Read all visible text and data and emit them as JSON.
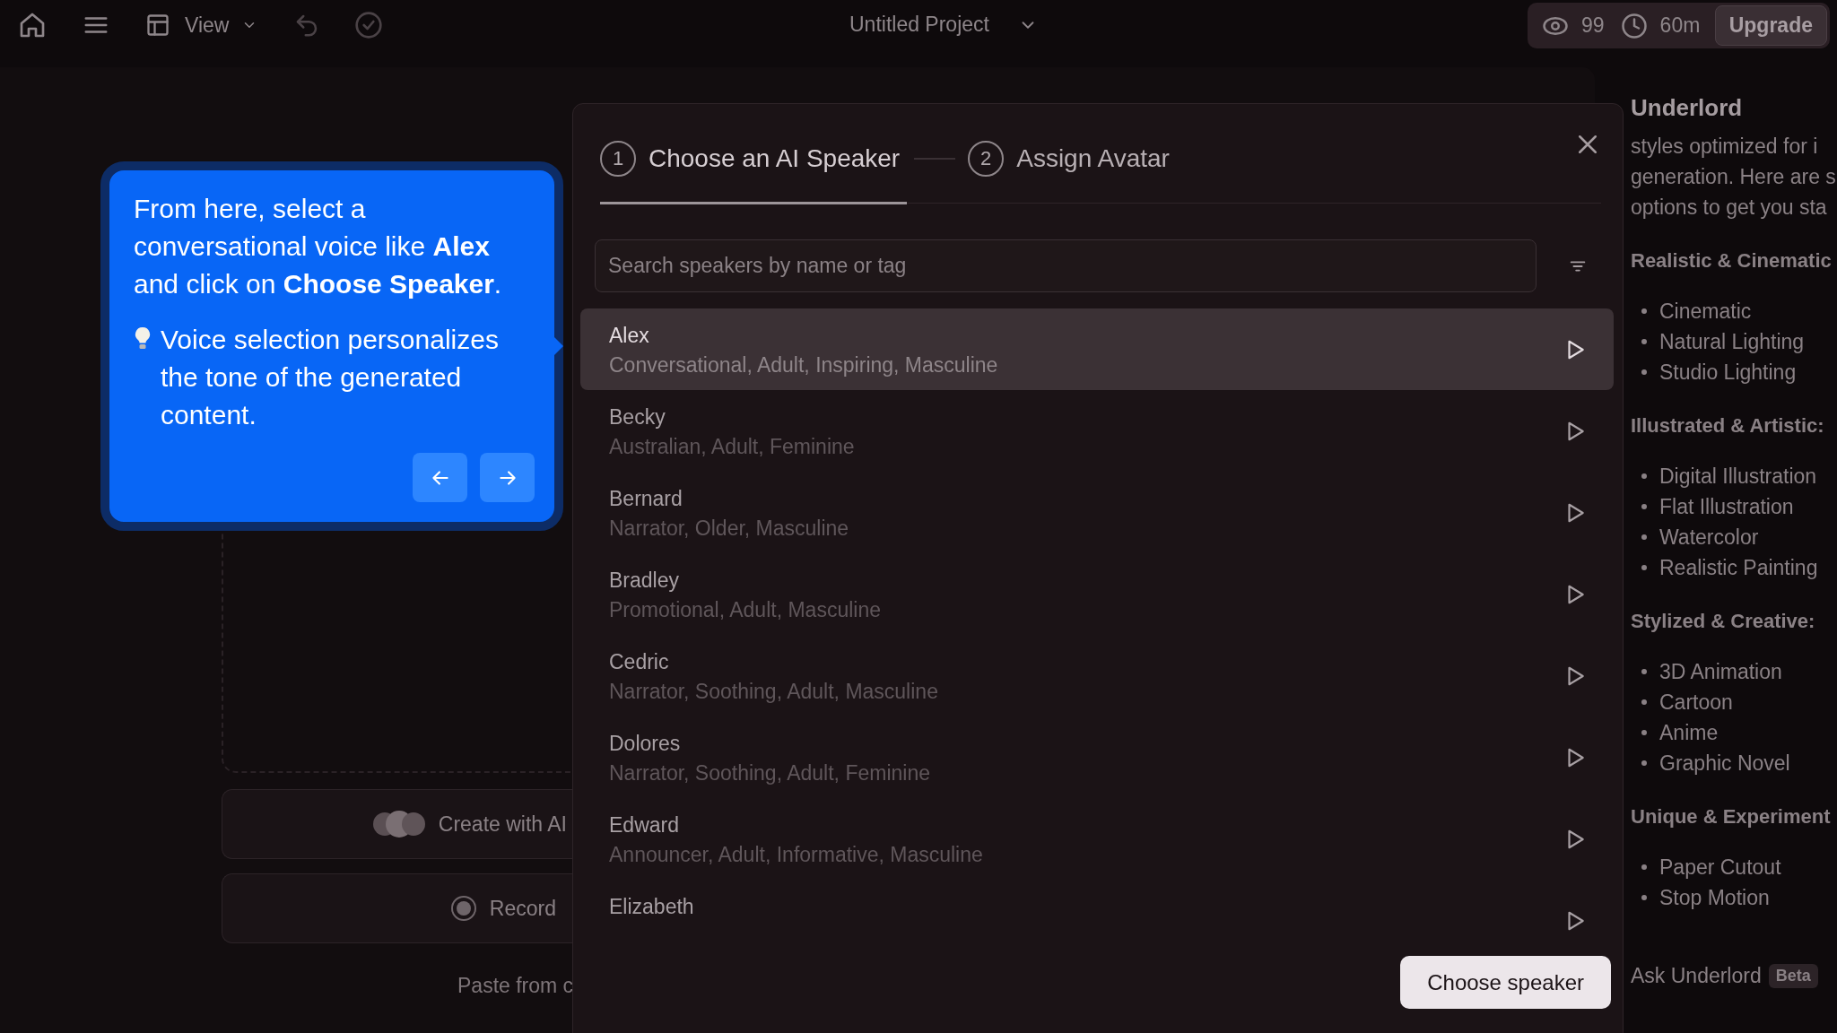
{
  "top_bar": {
    "view_label": "View",
    "project_title": "Untitled Project",
    "credits": "99",
    "time_left": "60m",
    "upgrade_button": "Upgrade"
  },
  "workspace": {
    "create_button": "Create with AI",
    "record_button": "Record",
    "paste_text": "Paste from c"
  },
  "tour_tooltip": {
    "paragraphs": [
      {
        "kind": "text",
        "text": "From here, select a conversational voice like **Alex** and click on **Choose Speaker**."
      },
      {
        "kind": "tip",
        "text": "Voice selection personalizes the tone of the generated content."
      }
    ]
  },
  "speaker_modal": {
    "steps": [
      {
        "number": "1",
        "label": "Choose an AI Speaker",
        "selected": true
      },
      {
        "number": "2",
        "label": "Assign Avatar",
        "selected": false
      }
    ],
    "search": {
      "placeholder": "Search speakers by name or tag"
    },
    "speakers": [
      {
        "name": "Alex",
        "tags": "Conversational, Adult, Inspiring, Masculine",
        "selected": true
      },
      {
        "name": "Becky",
        "tags": "Australian, Adult, Feminine",
        "selected": false
      },
      {
        "name": "Bernard",
        "tags": "Narrator, Older, Masculine",
        "selected": false
      },
      {
        "name": "Bradley",
        "tags": "Promotional, Adult, Masculine",
        "selected": false
      },
      {
        "name": "Cedric",
        "tags": "Narrator, Soothing, Adult, Masculine",
        "selected": false
      },
      {
        "name": "Dolores",
        "tags": "Narrator, Soothing, Adult, Feminine",
        "selected": false
      },
      {
        "name": "Edward",
        "tags": "Announcer, Adult, Informative, Masculine",
        "selected": false
      },
      {
        "name": "Elizabeth",
        "selected": false
      }
    ],
    "confirm_button": "Choose speaker"
  },
  "underlord_panel": {
    "title": "Underlord",
    "intro_lines": [
      "styles optimized for i",
      "generation. Here are s",
      "options to get you sta"
    ],
    "sections": [
      {
        "heading": "Realistic & Cinematic",
        "items": [
          "Cinematic",
          "Natural Lighting",
          "Studio Lighting"
        ]
      },
      {
        "heading": "Illustrated & Artistic:",
        "items": [
          "Digital Illustration",
          "Flat Illustration",
          "Watercolor",
          "Realistic Painting"
        ]
      },
      {
        "heading": "Stylized & Creative:",
        "items": [
          "3D Animation",
          "Cartoon",
          "Anime",
          "Graphic Novel"
        ]
      },
      {
        "heading": "Unique & Experiment",
        "items": [
          "Paper Cutout",
          "Stop Motion"
        ]
      }
    ],
    "ask_label": "Ask Underlord",
    "badge": "Beta"
  }
}
